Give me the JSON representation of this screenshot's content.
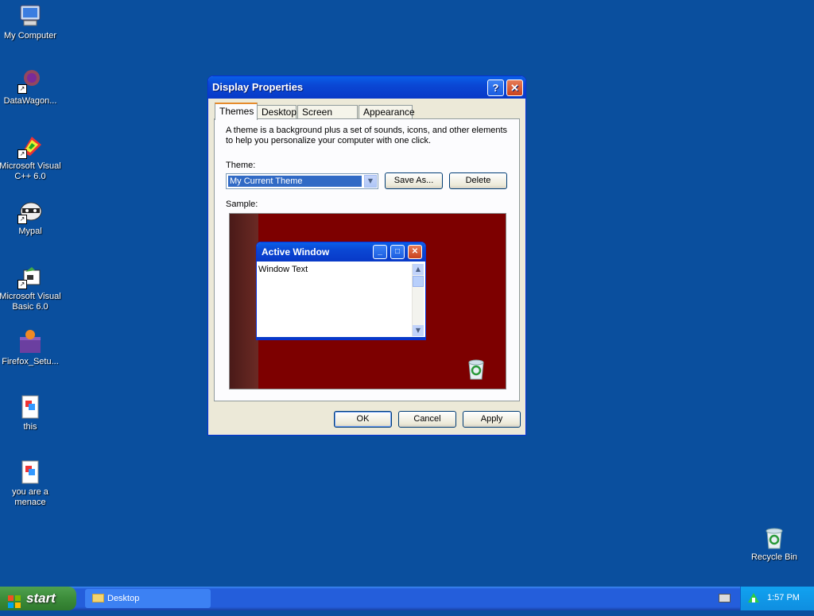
{
  "desktop": {
    "icons": [
      {
        "label": "My Computer",
        "icon": "my-computer-icon"
      },
      {
        "label": "DataWagon...",
        "icon": "datawagon-icon"
      },
      {
        "label": "Microsoft Visual C++ 6.0",
        "icon": "visual-cpp-icon"
      },
      {
        "label": "Mypal",
        "icon": "mypal-icon"
      },
      {
        "label": "Microsoft Visual Basic 6.0",
        "icon": "visual-basic-icon"
      },
      {
        "label": "Firefox_Setu...",
        "icon": "firefox-setup-icon"
      },
      {
        "label": "this",
        "icon": "document-icon"
      },
      {
        "label": "you are a menace",
        "icon": "document-icon"
      },
      {
        "label": "Recycle Bin",
        "icon": "recycle-bin-icon"
      }
    ]
  },
  "dialog": {
    "title": "Display Properties",
    "help_glyph": "?",
    "close_glyph": "✕",
    "tabs": [
      "Themes",
      "Desktop",
      "Screen Saver",
      "Appearance"
    ],
    "active_tab": "Themes",
    "description": "A theme is a background plus a set of sounds, icons, and other elements to help you personalize your computer with one click.",
    "theme_label": "Theme:",
    "theme_value": "My Current Theme",
    "save_as_label": "Save As...",
    "delete_label": "Delete",
    "sample_label": "Sample:",
    "sample": {
      "window_title": "Active Window",
      "window_text": "Window Text"
    },
    "ok_label": "OK",
    "cancel_label": "Cancel",
    "apply_label": "Apply"
  },
  "taskbar": {
    "start_label": "start",
    "task_label": "Desktop",
    "clock": "1:57 PM"
  },
  "colors": {
    "desktop": "#0a4f9e",
    "title_bar": "#0a47d4",
    "sample_bg": "#7d0000"
  }
}
